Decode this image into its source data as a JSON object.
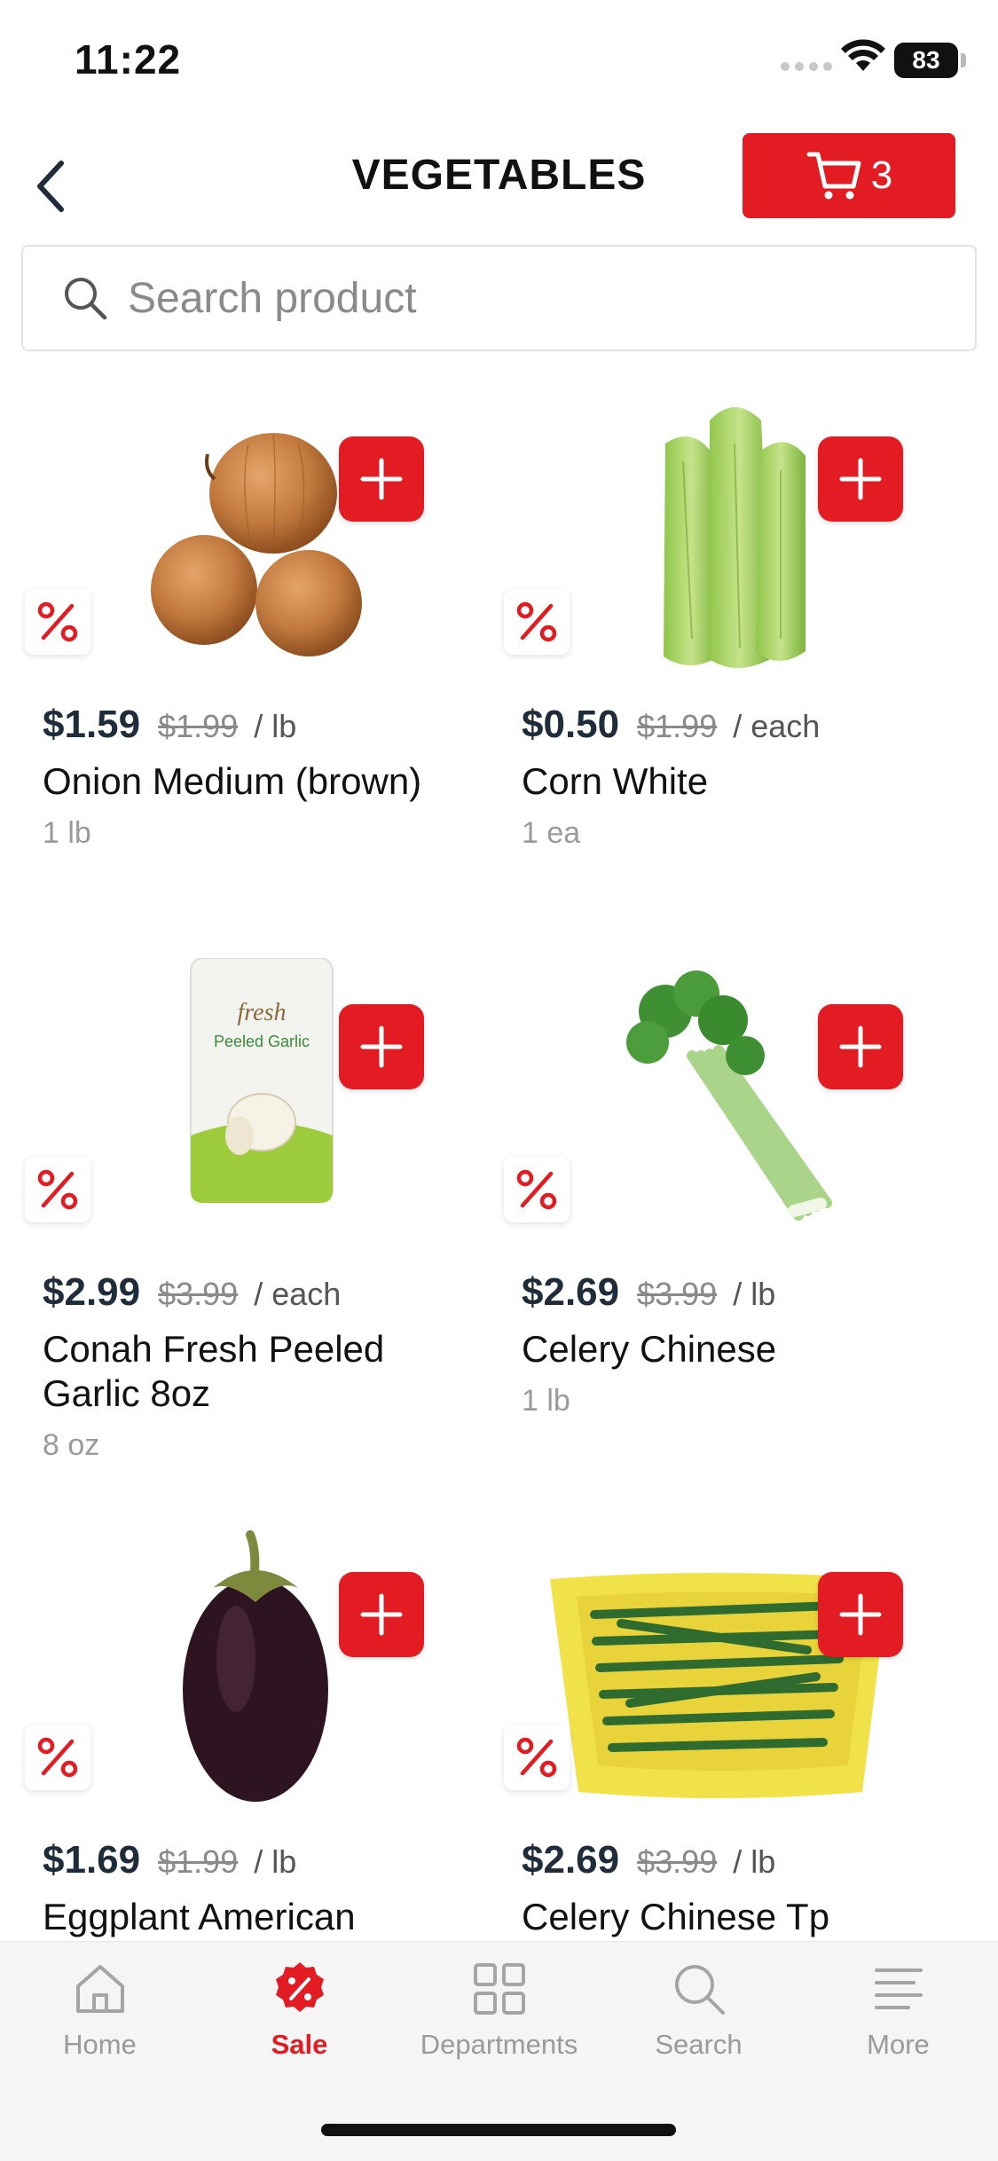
{
  "status": {
    "time": "11:22",
    "battery": "83"
  },
  "header": {
    "title": "VEGETABLES",
    "cart_count": "3"
  },
  "search": {
    "placeholder": "Search product"
  },
  "products": [
    {
      "price": "$1.59",
      "old_price": "$1.99",
      "unit": "/ lb",
      "name": "Onion Medium (brown)",
      "size": "1 lb",
      "image_icon": "onion-image"
    },
    {
      "price": "$0.50",
      "old_price": "$1.99",
      "unit": "/ each",
      "name": "Corn White",
      "size": "1 ea",
      "image_icon": "corn-image"
    },
    {
      "price": "$2.99",
      "old_price": "$3.99",
      "unit": "/ each",
      "name": "Conah Fresh Peeled Garlic 8oz",
      "size": "8 oz",
      "image_icon": "garlic-package-image"
    },
    {
      "price": "$2.69",
      "old_price": "$3.99",
      "unit": "/ lb",
      "name": "Celery Chinese",
      "size": "1 lb",
      "image_icon": "celery-image"
    },
    {
      "price": "$1.69",
      "old_price": "$1.99",
      "unit": "/ lb",
      "name": "Eggplant American",
      "size": "",
      "image_icon": "eggplant-image"
    },
    {
      "price": "$2.69",
      "old_price": "$3.99",
      "unit": "/ lb",
      "name": "Celery Chinese Tp",
      "size": "",
      "image_icon": "celery-tray-image"
    }
  ],
  "tabs": [
    {
      "label": "Home",
      "icon": "home-icon"
    },
    {
      "label": "Sale",
      "icon": "sale-icon",
      "active": true
    },
    {
      "label": "Departments",
      "icon": "grid-icon"
    },
    {
      "label": "Search",
      "icon": "search-icon"
    },
    {
      "label": "More",
      "icon": "menu-icon"
    }
  ],
  "colors": {
    "accent": "#e31b23",
    "price": "#1f2c3a",
    "muted": "#9b9b9b"
  }
}
